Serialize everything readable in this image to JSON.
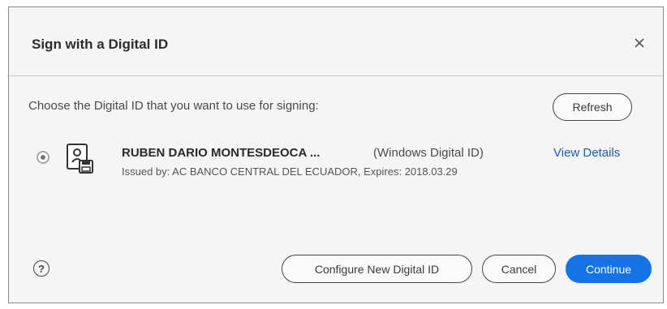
{
  "dialog": {
    "title": "Sign with a Digital ID",
    "close_icon": "close-icon"
  },
  "prompt": "Choose the Digital ID that you want to use for signing:",
  "refresh_label": "Refresh",
  "digital_id": {
    "selected": true,
    "icon": "digital-id-card-icon",
    "name": "RUBEN DARIO MONTESDEOCA ...",
    "type": "(Windows Digital ID)",
    "issued": "Issued by: AC BANCO CENTRAL DEL ECUADOR, Expires: 2018.03.29",
    "view_details_label": "View Details"
  },
  "footer": {
    "help_icon": "help-icon",
    "help_glyph": "?",
    "configure_label": "Configure New Digital ID",
    "cancel_label": "Cancel",
    "continue_label": "Continue"
  },
  "colors": {
    "accent": "#1473e6",
    "link": "#1b5cb8",
    "dialog_background": "#f5f5f5"
  }
}
